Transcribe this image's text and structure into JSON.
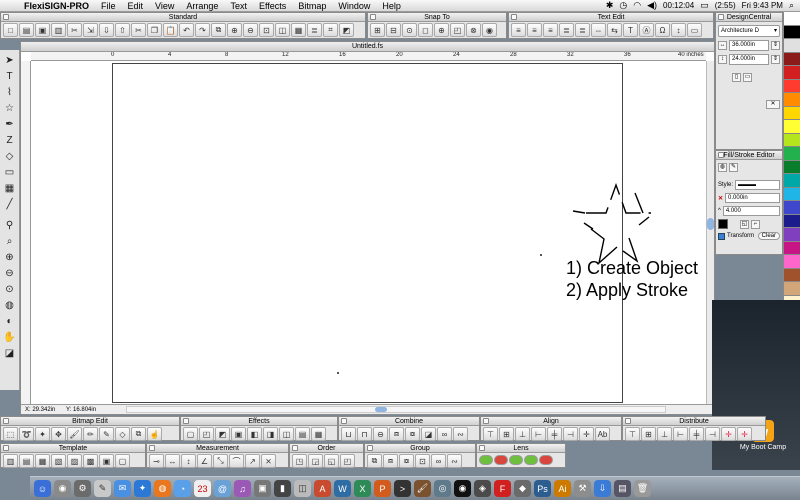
{
  "menubar": {
    "app_name": "FlexiSIGN-PRO",
    "menus": [
      "File",
      "Edit",
      "View",
      "Arrange",
      "Text",
      "Effects",
      "Bitmap",
      "Window",
      "Help"
    ],
    "battery": "(2:55)",
    "clock_timer": "00:12:04",
    "datetime": "Fri 9:43 PM"
  },
  "toolbars": {
    "standard": "Standard",
    "snap_to": "Snap To",
    "text_edit": "Text Edit"
  },
  "document": {
    "title": "Untitled.fs",
    "ruler_labels": [
      "0",
      "4",
      "8",
      "12",
      "16",
      "20",
      "24",
      "28",
      "32",
      "36",
      "40 inches"
    ],
    "status_x": "29.342in",
    "status_y": "16.804in",
    "status_x_label": "X:",
    "status_y_label": "Y:"
  },
  "canvas": {
    "line1": "1) Create Object",
    "line2": "2) Apply Stroke"
  },
  "design_central": {
    "title": "DesignCentral",
    "preset": "Architecture D",
    "width": "36.000in",
    "height": "24.000in"
  },
  "fill_stroke": {
    "title": "Fill/Stroke Editor",
    "style_label": "Style:",
    "stroke_width": "0.000in",
    "miter": "4.000",
    "transform_label": "Transform",
    "clear_label": "Clear"
  },
  "bottom_palettes": {
    "bitmap_edit": "Bitmap Edit",
    "effects": "Effects",
    "combine": "Combine",
    "align": "Align",
    "distribute": "Distribute",
    "template": "Template",
    "measurement": "Measurement",
    "order": "Order",
    "group": "Group",
    "lens": "Lens"
  },
  "desktop": {
    "drive_label": "My Boot Camp"
  },
  "colors": {
    "accent_blue": "#8fb5e0",
    "palette": [
      "#ffffff",
      "#000000",
      "#e0e0e0",
      "#8b1a1a",
      "#d21f1f",
      "#ff3b30",
      "#ff8c00",
      "#ffd700",
      "#ffff33",
      "#b5e61d",
      "#22b14c",
      "#0a7d2c",
      "#00a8a8",
      "#1fb5e6",
      "#3f48cc",
      "#1c1c8c",
      "#7f3fbf",
      "#c71585",
      "#ff66cc",
      "#a0522d",
      "#d2a679",
      "#fff2cc",
      "#ccffcc",
      "#99ccff",
      "#cc99ff",
      "#ff9999",
      "#66ff66",
      "#009999",
      "#003366",
      "#660066"
    ]
  }
}
